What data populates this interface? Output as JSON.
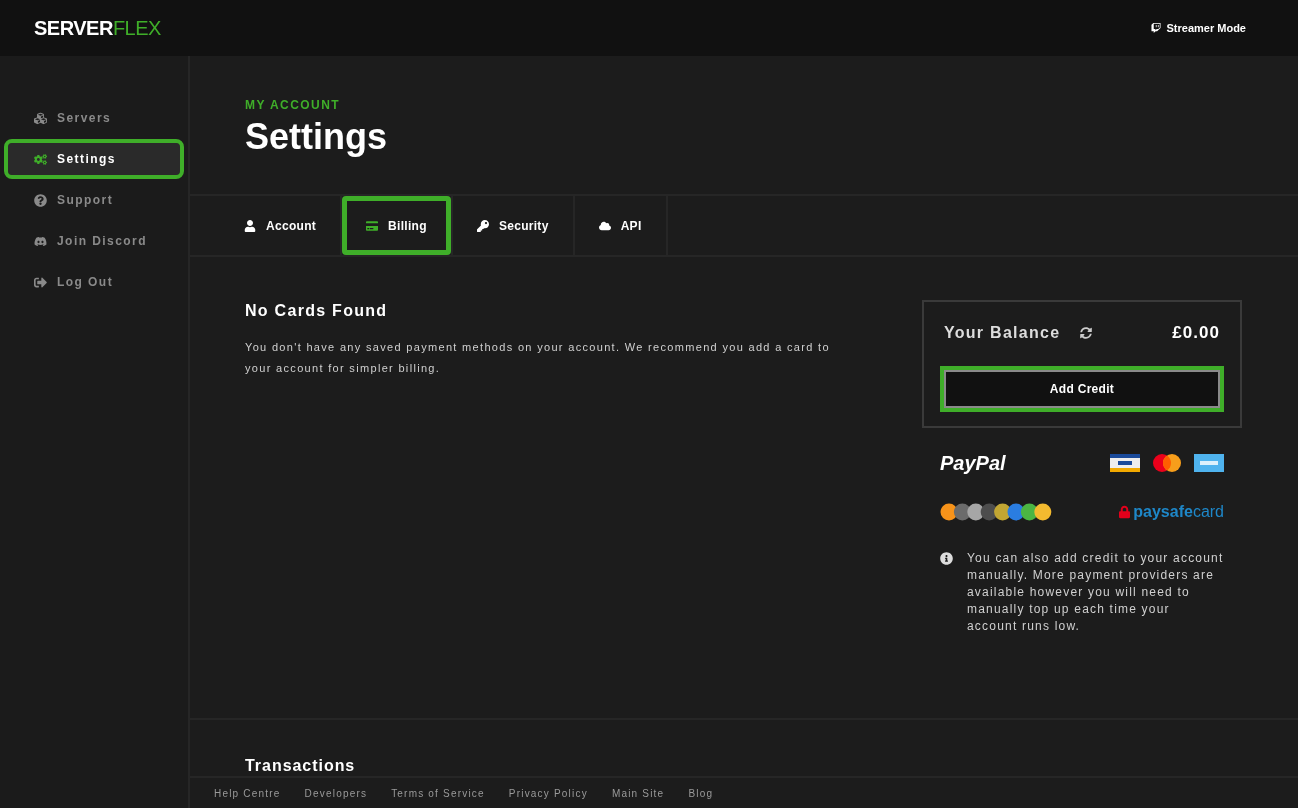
{
  "header": {
    "logo_primary": "SERVER",
    "logo_secondary": "FLEX",
    "streamer_mode": "Streamer Mode"
  },
  "sidebar": {
    "items": [
      {
        "kind": "servers",
        "label": "Servers",
        "selected": false,
        "highlighted": false
      },
      {
        "kind": "settings",
        "label": "Settings",
        "selected": true,
        "highlighted": true
      },
      {
        "kind": "support",
        "label": "Support",
        "selected": false,
        "highlighted": false
      },
      {
        "kind": "discord",
        "label": "Join Discord",
        "selected": false,
        "highlighted": false
      },
      {
        "kind": "logout",
        "label": "Log Out",
        "selected": false,
        "highlighted": false
      }
    ]
  },
  "page": {
    "eyebrow": "MY ACCOUNT",
    "title": "Settings"
  },
  "tabs": [
    {
      "kind": "account",
      "label": "Account",
      "selected": false,
      "highlighted": false
    },
    {
      "kind": "billing",
      "label": "Billing",
      "selected": true,
      "highlighted": true
    },
    {
      "kind": "security",
      "label": "Security",
      "selected": false,
      "highlighted": false
    },
    {
      "kind": "api",
      "label": "API",
      "selected": false,
      "highlighted": false
    }
  ],
  "cards": {
    "title": "No Cards Found",
    "text": "You don't have any saved payment methods on your account. We recommend you add a card to your account for simpler billing."
  },
  "balance": {
    "label": "Your Balance",
    "amount": "£0.00",
    "button": {
      "label": "Add Credit",
      "highlighted": true
    }
  },
  "providers": {
    "paypal": "PayPal",
    "paysafe_primary": "paysafe",
    "paysafe_secondary": "card"
  },
  "note": "You can also add credit to your account manually. More payment providers are available however you will need to manually top up each time your account runs low.",
  "transactions": {
    "title": "Transactions"
  },
  "footer": {
    "links": [
      "Help Centre",
      "Developers",
      "Terms of Service",
      "Privacy Policy",
      "Main Site",
      "Blog"
    ]
  }
}
